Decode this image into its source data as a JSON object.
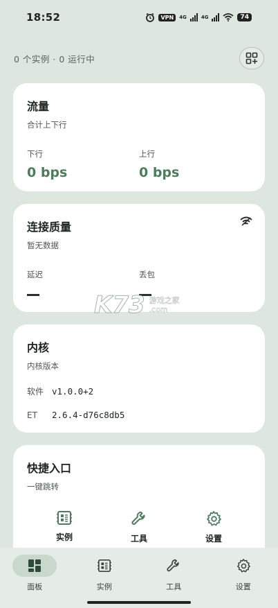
{
  "status_bar": {
    "time": "18:52",
    "vpn": "VPN",
    "net1": "4G",
    "net2": "4G",
    "battery": "74"
  },
  "summary": {
    "text": "0 个实例 · 0 运行中",
    "add_icon": "grid-add-icon"
  },
  "traffic": {
    "title": "流量",
    "subtitle": "合计上下行",
    "down_label": "下行",
    "down_value": "0 bps",
    "up_label": "上行",
    "up_value": "0 bps"
  },
  "quality": {
    "title": "连接质量",
    "subtitle": "暂无数据",
    "latency_label": "延迟",
    "loss_label": "丢包",
    "icon": "wifi-icon"
  },
  "core": {
    "title": "内核",
    "subtitle": "内核版本",
    "rows": [
      {
        "key": "软件",
        "value": "v1.0.0+2"
      },
      {
        "key": "ET",
        "value": "2.6.4-d76c8db5"
      }
    ]
  },
  "shortcuts": {
    "title": "快捷入口",
    "subtitle": "一键跳转",
    "items": [
      {
        "label": "实例",
        "icon": "instance-icon"
      },
      {
        "label": "工具",
        "icon": "wrench-icon"
      },
      {
        "label": "设置",
        "icon": "gear-icon"
      }
    ]
  },
  "bottom_nav": {
    "items": [
      {
        "label": "面板",
        "icon": "dashboard-icon",
        "active": true
      },
      {
        "label": "实例",
        "icon": "instance-icon",
        "active": false
      },
      {
        "label": "工具",
        "icon": "wrench-icon",
        "active": false
      },
      {
        "label": "设置",
        "icon": "gear-icon",
        "active": false
      }
    ]
  },
  "watermark": {
    "big": "K73",
    "line1": "游戏之家",
    "line2": ".com"
  },
  "colors": {
    "background": "#dde7e0",
    "accent": "#4d7d5d",
    "card": "#ffffff"
  }
}
